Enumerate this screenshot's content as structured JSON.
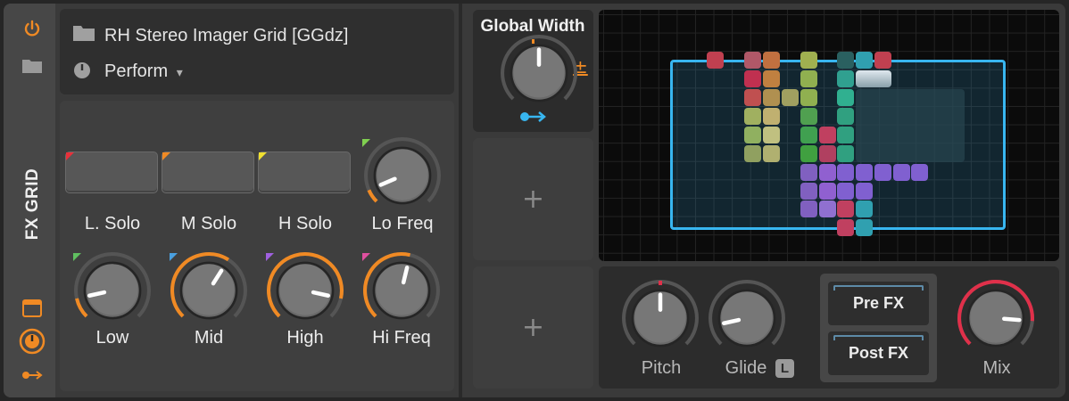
{
  "device": {
    "sidebar_title": "FX GRID",
    "name": "RH Stereo Imager Grid [GGdz]",
    "preset": "Perform",
    "preset_arrow": "▾"
  },
  "solo_buttons": [
    {
      "label": "L. Solo",
      "color": "#e8303a"
    },
    {
      "label": "M Solo",
      "color": "#f08a24"
    },
    {
      "label": "H Solo",
      "color": "#f0e030"
    }
  ],
  "knobs": {
    "lo_freq": {
      "label": "Lo Freq",
      "mod_color": "#80d050",
      "value": 0.08
    },
    "low": {
      "label": "Low",
      "mod_color": "#60c060",
      "value": 0.12
    },
    "mid": {
      "label": "Mid",
      "mod_color": "#4aa0e0",
      "value": 0.62
    },
    "high": {
      "label": "High",
      "mod_color": "#a060e0",
      "value": 0.88
    },
    "hi_freq": {
      "label": "Hi Freq",
      "mod_color": "#e050a0",
      "value": 0.55
    },
    "global_width": {
      "label": "Global Width",
      "value": 0.5,
      "mod_symbol": "±"
    },
    "pitch": {
      "label": "Pitch",
      "value": 0.5
    },
    "glide": {
      "label": "Glide",
      "value": 0.12,
      "badge": "L"
    },
    "mix": {
      "label": "Mix",
      "value": 0.85
    }
  },
  "slots": {
    "add_symbol": "+"
  },
  "routing": {
    "pre_fx": "Pre FX",
    "post_fx": "Post FX"
  },
  "colors": {
    "accent": "#f08a24",
    "selection": "#38b6f0",
    "mix_ring": "#e0304a"
  }
}
